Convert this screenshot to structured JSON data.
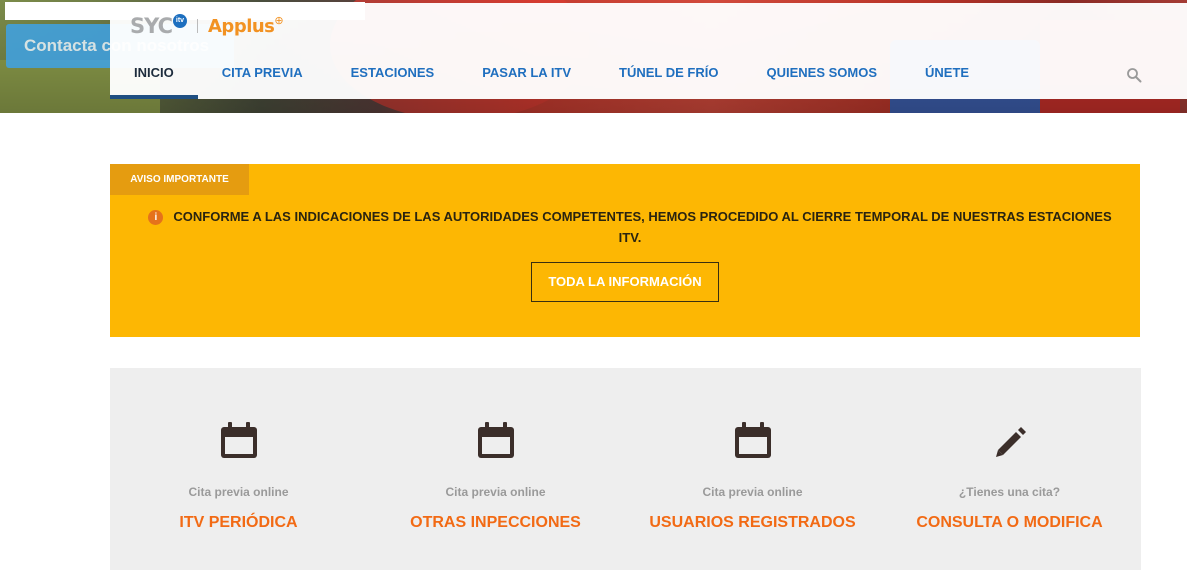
{
  "hero": {
    "contact_label": "Contacta con nosotros"
  },
  "logo": {
    "brand_left": "SYC",
    "brand_badge": "itv",
    "brand_right": "Applus",
    "brand_plus": "⊕"
  },
  "nav": {
    "items": [
      {
        "label": "INICIO",
        "active": true
      },
      {
        "label": "CITA PREVIA"
      },
      {
        "label": "ESTACIONES"
      },
      {
        "label": "PASAR LA ITV"
      },
      {
        "label": "TÚNEL DE FRÍO"
      },
      {
        "label": "QUIENES SOMOS"
      },
      {
        "label": "ÚNETE"
      }
    ],
    "search_icon": "search-icon"
  },
  "notice": {
    "tag": "AVISO IMPORTANTE",
    "icon": "info-icon",
    "message": "CONFORME A LAS INDICACIONES DE LAS AUTORIDADES COMPETENTES, HEMOS PROCEDIDO AL CIERRE TEMPORAL DE NUESTRAS ESTACIONES ITV.",
    "button": "TODA LA INFORMACIÓN",
    "colors": {
      "background": "#fdb703",
      "tag": "#e59c10",
      "info_icon": "#e5721b"
    }
  },
  "services": [
    {
      "icon": "calendar-icon",
      "label": "Cita previa online",
      "title": "ITV PERIÓDICA"
    },
    {
      "icon": "calendar-icon",
      "label": "Cita previa online",
      "title": "OTRAS INPECCIONES"
    },
    {
      "icon": "calendar-icon",
      "label": "Cita previa online",
      "title": "USUARIOS REGISTRADOS"
    },
    {
      "icon": "pencil-icon",
      "label": "¿Tienes una cita?",
      "title": "CONSULTA O MODIFICA"
    }
  ],
  "colors": {
    "accent": "#f26a14",
    "nav_link": "#1f6fbf",
    "nav_active_bar": "#1f4f82"
  }
}
